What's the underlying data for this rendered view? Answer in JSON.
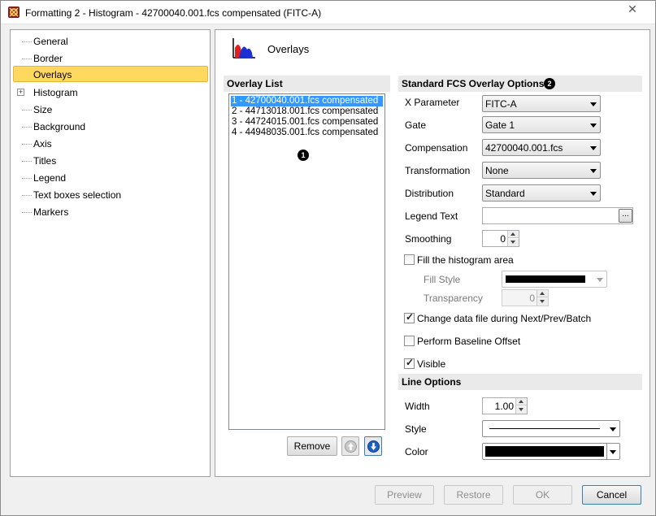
{
  "window": {
    "title": "Formatting 2 - Histogram - 42700040.001.fcs compensated (FITC-A)",
    "close_glyph": "✕",
    "app_icon": "fcs-express-icon"
  },
  "sidebar": {
    "items": [
      {
        "label": "General"
      },
      {
        "label": "Border"
      },
      {
        "label": "Overlays",
        "selected": true
      },
      {
        "label": "Histogram",
        "expandable": true,
        "expander_glyph": "+"
      },
      {
        "label": "Size"
      },
      {
        "label": "Background"
      },
      {
        "label": "Axis"
      },
      {
        "label": "Titles"
      },
      {
        "label": "Legend"
      },
      {
        "label": "Text boxes selection"
      },
      {
        "label": "Markers"
      }
    ]
  },
  "page": {
    "title": "Overlays",
    "icon": "histogram-overlay-icon"
  },
  "overlay_list": {
    "header": "Overlay List",
    "badge": "1",
    "items": [
      "1 - 42700040.001.fcs compensated",
      "2 - 44713018.001.fcs compensated",
      "3 - 44724015.001.fcs compensated",
      "4 - 44948035.001.fcs compensated"
    ],
    "selected_index": 0,
    "remove_label": "Remove"
  },
  "options": {
    "header": "Standard FCS Overlay Options",
    "badge": "2",
    "x_parameter": {
      "label": "X Parameter",
      "value": "FITC-A"
    },
    "gate": {
      "label": "Gate",
      "value": "Gate 1"
    },
    "compensation": {
      "label": "Compensation",
      "value": "42700040.001.fcs"
    },
    "transformation": {
      "label": "Transformation",
      "value": "None"
    },
    "distribution": {
      "label": "Distribution",
      "value": "Standard"
    },
    "legend_text": {
      "label": "Legend Text",
      "value": "",
      "button": "..."
    },
    "smoothing": {
      "label": "Smoothing",
      "value": "0"
    },
    "fill_area": {
      "label": "Fill the histogram area",
      "checked": false
    },
    "fill_style": {
      "label": "Fill Style",
      "color": "#000000"
    },
    "transparency": {
      "label": "Transparency",
      "value": "0"
    },
    "change_data_file": {
      "label": "Change data file during Next/Prev/Batch",
      "checked": true
    },
    "baseline_offset": {
      "label": "Perform Baseline Offset",
      "checked": false
    },
    "visible": {
      "label": "Visible",
      "checked": true
    }
  },
  "line_options": {
    "header": "Line Options",
    "width": {
      "label": "Width",
      "value": "1.00"
    },
    "style": {
      "label": "Style"
    },
    "color": {
      "label": "Color",
      "value": "#000000"
    }
  },
  "footer": {
    "preview": "Preview",
    "restore": "Restore",
    "ok": "OK",
    "cancel": "Cancel"
  },
  "colors": {
    "selection_highlight": "#ffd95e",
    "list_selection": "#3399ff"
  }
}
